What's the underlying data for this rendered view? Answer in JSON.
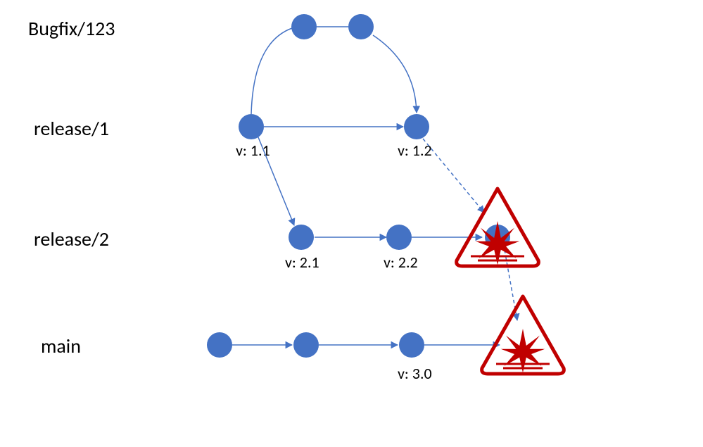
{
  "branches": {
    "bugfix": "Bugfix/123",
    "release1": "release/1",
    "release2": "release/2",
    "main": "main"
  },
  "versions": {
    "v11": "v: 1.1",
    "v12": "v: 1.2",
    "v21": "v: 2.1",
    "v22": "v: 2.2",
    "v30": "v: 3.0"
  },
  "colors": {
    "node": "#4472C4",
    "edge": "#4472C4",
    "warning": "#C00000"
  }
}
